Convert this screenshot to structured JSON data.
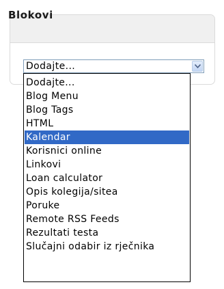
{
  "block": {
    "title": "Blokovi"
  },
  "select": {
    "value": "Dodajte...",
    "arrow_icon": "chevron-down-icon"
  },
  "dropdown": {
    "highlighted_index": 4,
    "highlight_color": "#3169c6",
    "options": [
      "Dodajte...",
      "Blog Menu",
      "Blog Tags",
      "HTML",
      "Kalendar",
      "Korisnici online",
      "Linkovi",
      "Loan calculator",
      "Opis kolegija/sitea",
      "Poruke",
      "Remote RSS Feeds",
      "Rezultati testa",
      "Slučajni odabir iz rječnika"
    ]
  }
}
